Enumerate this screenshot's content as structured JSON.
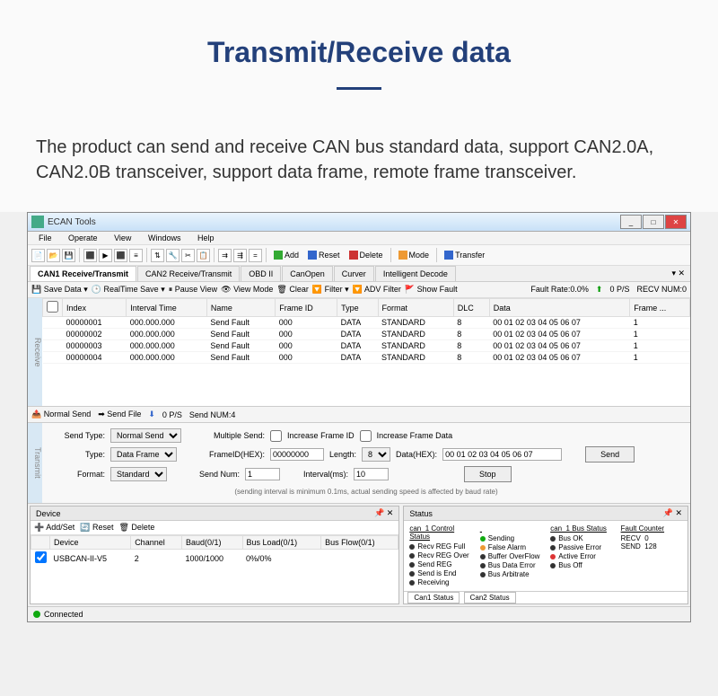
{
  "page": {
    "title": "Transmit/Receive data",
    "description": "The product can send and receive CAN bus standard data, support CAN2.0A, CAN2.0B transceiver, support data frame, remote frame transceiver."
  },
  "window": {
    "title": "ECAN Tools"
  },
  "menu": {
    "file": "File",
    "operate": "Operate",
    "view": "View",
    "windows": "Windows",
    "help": "Help"
  },
  "toolbar": {
    "add": "Add",
    "reset": "Reset",
    "delete": "Delete",
    "mode": "Mode",
    "transfer": "Transfer"
  },
  "tabs": {
    "t1": "CAN1 Receive/Transmit",
    "t2": "CAN2 Receive/Transmit",
    "t3": "OBD II",
    "t4": "CanOpen",
    "t5": "Curver",
    "t6": "Intelligent Decode"
  },
  "subtoolbar": {
    "saveData": "Save Data",
    "realtime": "RealTime Save",
    "pause": "Pause View",
    "viewMode": "View Mode",
    "clear": "Clear",
    "filter": "Filter",
    "advFilter": "ADV Filter",
    "showFault": "Show Fault",
    "faultRate": "Fault Rate:0.0%",
    "ps": "0 P/S",
    "recv": "RECV NUM:0"
  },
  "gridHeaders": {
    "index": "Index",
    "interval": "Interval Time",
    "name": "Name",
    "frameId": "Frame ID",
    "type": "Type",
    "format": "Format",
    "dlc": "DLC",
    "data": "Data",
    "frame": "Frame ..."
  },
  "gridRows": [
    {
      "index": "00000001",
      "interval": "000.000.000",
      "name": "Send Fault",
      "frameId": "000",
      "type": "DATA",
      "format": "STANDARD",
      "dlc": "8",
      "data": "00 01 02 03 04 05 06 07",
      "frame": "1"
    },
    {
      "index": "00000002",
      "interval": "000.000.000",
      "name": "Send Fault",
      "frameId": "000",
      "type": "DATA",
      "format": "STANDARD",
      "dlc": "8",
      "data": "00 01 02 03 04 05 06 07",
      "frame": "1"
    },
    {
      "index": "00000003",
      "interval": "000.000.000",
      "name": "Send Fault",
      "frameId": "000",
      "type": "DATA",
      "format": "STANDARD",
      "dlc": "8",
      "data": "00 01 02 03 04 05 06 07",
      "frame": "1"
    },
    {
      "index": "00000004",
      "interval": "000.000.000",
      "name": "Send Fault",
      "frameId": "000",
      "type": "DATA",
      "format": "STANDARD",
      "dlc": "8",
      "data": "00 01 02 03 04 05 06 07",
      "frame": "1"
    }
  ],
  "sideLabels": {
    "receive": "Receive",
    "transmit": "Transmit"
  },
  "sendToolbar": {
    "normalSend": "Normal Send",
    "sendFile": "Send File",
    "ps": "0 P/S",
    "sendNum": "Send NUM:4"
  },
  "transmit": {
    "sendTypeLabel": "Send Type:",
    "sendType": "Normal Send",
    "multipleSend": "Multiple Send:",
    "incFrameId": "Increase Frame ID",
    "incFrameData": "Increase Frame Data",
    "typeLabel": "Type:",
    "type": "Data Frame",
    "frameIdLabel": "FrameID(HEX):",
    "frameId": "00000000",
    "lengthLabel": "Length:",
    "length": "8",
    "dataLabel": "Data(HEX):",
    "data": "00 01 02 03 04 05 06 07",
    "formatLabel": "Format:",
    "format": "Standard",
    "sendNumLabel": "Send Num:",
    "sendNum": "1",
    "intervalLabel": "Interval(ms):",
    "interval": "10",
    "sendBtn": "Send",
    "stopBtn": "Stop",
    "note": "(sending interval is minimum 0.1ms, actual sending speed is affected by baud rate)"
  },
  "device": {
    "title": "Device",
    "addSet": "Add/Set",
    "reset": "Reset",
    "delete": "Delete",
    "headers": {
      "device": "Device",
      "channel": "Channel",
      "baud": "Baud(0/1)",
      "busLoad": "Bus Load(0/1)",
      "busFlow": "Bus Flow(0/1)"
    },
    "row": {
      "device": "USBCAN-II-V5",
      "channel": "2",
      "baud": "1000/1000",
      "busLoad": "0%/0%",
      "busFlow": ""
    }
  },
  "status": {
    "title": "Status",
    "ctrlHeader": "can_1 Control Status",
    "busHeader": "can_1 Bus Status",
    "faultHeader": "Fault Counter",
    "ctrl": {
      "recvRegFull": "Recv REG Full",
      "recvRegOver": "Recv REG Over",
      "sendReg": "Send REG",
      "sendEnd": "Send is End",
      "receiving": "Receiving",
      "sending": "Sending",
      "falseAlarm": "False Alarm",
      "bufferOverflow": "Buffer OverFlow",
      "busDataError": "Bus Data Error",
      "busArbitrate": "Bus Arbitrate"
    },
    "bus": {
      "busOk": "Bus OK",
      "passiveError": "Passive Error",
      "activeError": "Active Error",
      "busOff": "Bus Off"
    },
    "fault": {
      "recvLabel": "RECV",
      "recv": "0",
      "sendLabel": "SEND",
      "send": "128"
    },
    "tabs": {
      "can1": "Can1 Status",
      "can2": "Can2 Status"
    }
  },
  "statusbar": {
    "connected": "Connected"
  }
}
